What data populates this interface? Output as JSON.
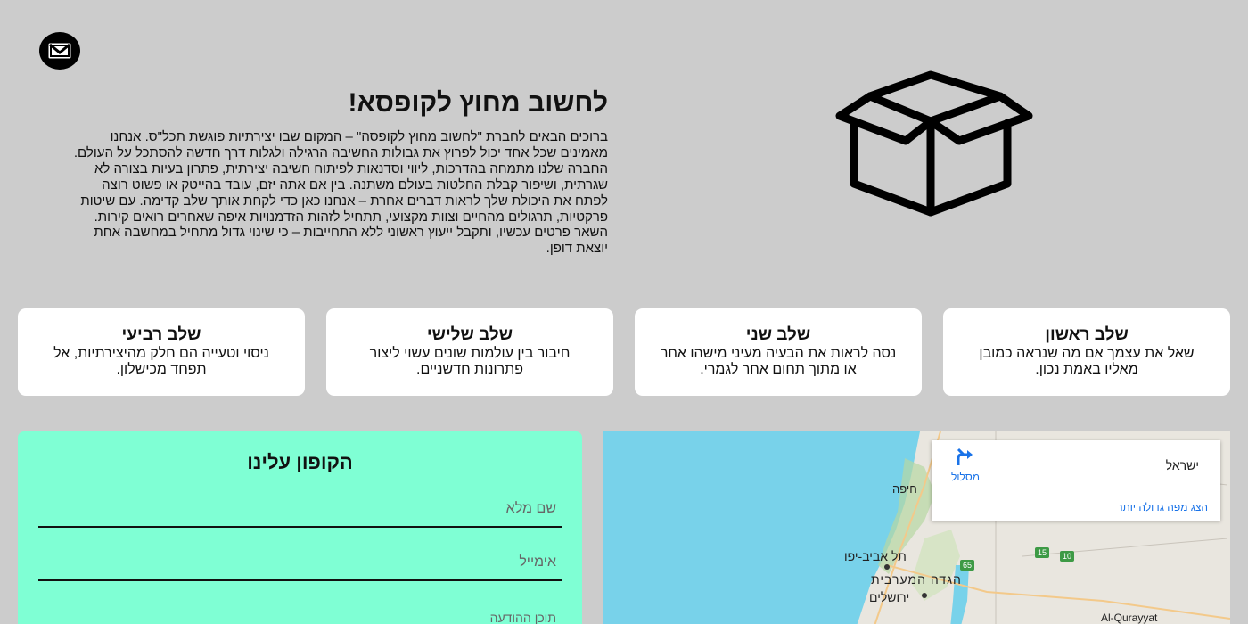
{
  "header": {
    "mail_icon": "envelope-icon"
  },
  "hero": {
    "title": "לחשוב מחוץ לקופסא!",
    "text": "ברוכים הבאים לחברת \"לחשוב מחוץ לקופסה\" – המקום שבו יצירתיות פוגשת תכל\"ס. אנחנו מאמינים שכל אחד יכול לפרוץ את גבולות החשיבה הרגילה ולגלות דרך חדשה להסתכל על העולם. החברה שלנו מתמחה בהדרכות, ליווי וסדנאות לפיתוח חשיבה יצירתית, פתרון בעיות בצורה לא שגרתית, ושיפור קבלת החלטות בעולם משתנה. בין אם אתה יזם, עובד בהייטק או פשוט רוצה לפתח את היכולת שלך לראות דברים אחרת – אנחנו כאן כדי לקחת אותך שלב קדימה. עם שיטות פרקטיות, תרגולים מהחיים וצוות מקצועי, תתחיל לזהות הזדמנויות איפה שאחרים רואים קירות. השאר פרטים עכשיו, ותקבל ייעוץ ראשוני ללא התחייבות – כי שינוי גדול מתחיל במחשבה אחת יוצאת דופן.",
    "illustration": "open-box-icon"
  },
  "steps": [
    {
      "title": "שלב ראשון",
      "text": "שאל את עצמך אם מה שנראה כמובן מאליו באמת נכון."
    },
    {
      "title": "שלב שני",
      "text": "נסה לראות את הבעיה מעיני מישהו אחר או מתוך תחום אחר לגמרי."
    },
    {
      "title": "שלב שלישי",
      "text": "חיבור בין עולמות שונים עשוי ליצור פתרונות חדשניים."
    },
    {
      "title": "שלב רביעי",
      "text": "ניסוי וטעייה הם חלק מהיצירתיות, אל תפחד מכישלון."
    }
  ],
  "coupon": {
    "title": "הקופון עלינו",
    "name_placeholder": "שם מלא",
    "email_placeholder": "אימייל",
    "message_placeholder": "תוכן ההודעה"
  },
  "map": {
    "place_title": "ישראל",
    "route_label": "מסלול",
    "larger_map_link": "הצג מפה גדולה יותר",
    "labels": {
      "haifa": "חיפה",
      "tel_aviv": "תל אביב-יפו",
      "west_bank": "הגדה המערבית",
      "jerusalem": "ירושלים",
      "al_qurayyat": "Al-Qurayyat",
      "road_65": "65",
      "road_15": "15",
      "road_10": "10"
    },
    "colors": {
      "sea": "#78d2ea",
      "land": "#e9e6df",
      "green": "#b7d7a3",
      "link": "#1a73e8"
    }
  }
}
